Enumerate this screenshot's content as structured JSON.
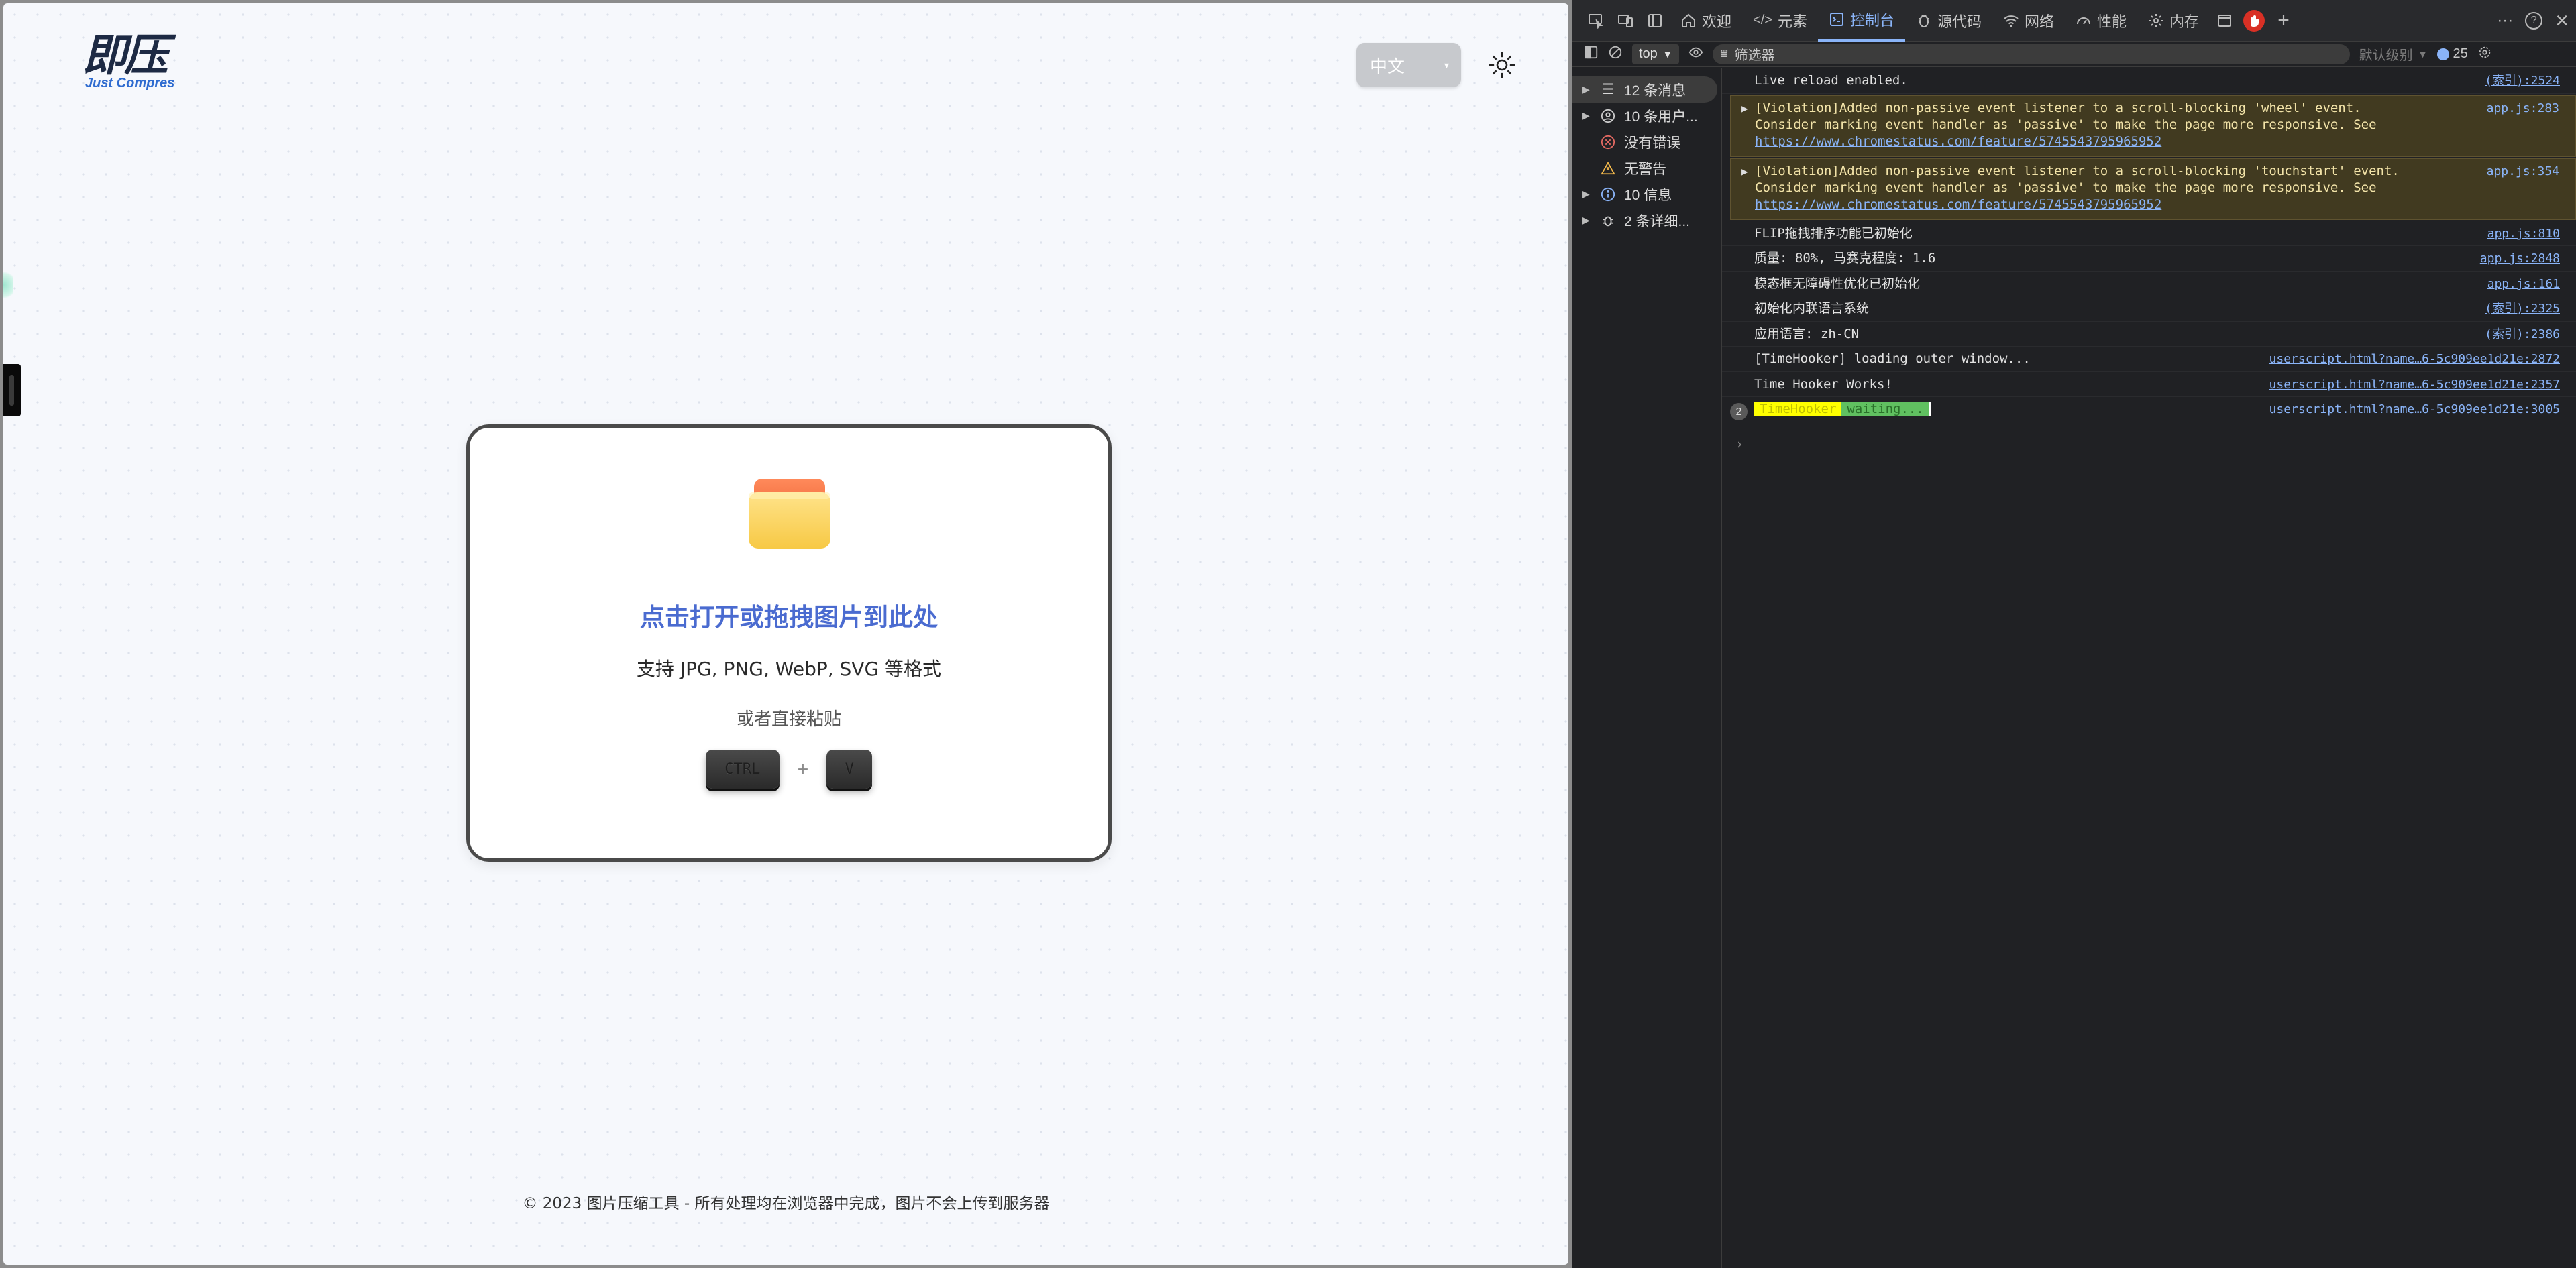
{
  "app": {
    "logo_text": "即压",
    "logo_sub": "Just Compres",
    "language": "中文",
    "dropzone": {
      "title": "点击打开或拖拽图片到此处",
      "formats": "支持 JPG, PNG, WebP, SVG 等格式",
      "paste_hint": "或者直接粘贴",
      "key_ctrl": "CTRL",
      "key_plus": "+",
      "key_v": "V"
    },
    "footer": "© 2023 图片压缩工具 - 所有处理均在浏览器中完成，图片不会上传到服务器"
  },
  "devtools": {
    "tabs": [
      {
        "label": "欢迎",
        "icon": "home-icon"
      },
      {
        "label": "元素",
        "icon": "code-icon"
      },
      {
        "label": "控制台",
        "icon": "console-icon",
        "active": true
      },
      {
        "label": "源代码",
        "icon": "bug-icon"
      },
      {
        "label": "网络",
        "icon": "wifi-icon"
      },
      {
        "label": "性能",
        "icon": "gauge-icon"
      },
      {
        "label": "内存",
        "icon": "gear-icon"
      }
    ],
    "toolbar": {
      "context": "top",
      "filter_placeholder": "筛选器",
      "level": "默认级别",
      "issues": "25"
    },
    "sidebar": [
      {
        "label": "12 条消息",
        "icon": "list-icon",
        "expandable": true,
        "selected": true
      },
      {
        "label": "10 条用户...",
        "icon": "user-icon",
        "expandable": true
      },
      {
        "label": "没有错误",
        "icon": "error-icon",
        "expandable": false
      },
      {
        "label": "无警告",
        "icon": "warning-icon",
        "expandable": false
      },
      {
        "label": "10 信息",
        "icon": "info-icon",
        "expandable": true
      },
      {
        "label": "2 条详细...",
        "icon": "bug-icon",
        "expandable": true
      }
    ],
    "logs": [
      {
        "msg": "Live reload enabled.",
        "src": "(索引):2524"
      },
      {
        "msg": "[Violation]Added non-passive event listener to a scroll-blocking 'wheel' event.\nConsider marking event handler as 'passive' to make the page more responsive. See",
        "link": "https://www.chromestatus.com/feature/5745543795965952",
        "src": "app.js:283",
        "type": "warn"
      },
      {
        "msg": "[Violation]Added non-passive event listener to a scroll-blocking 'touchstart' event.\nConsider marking event handler as 'passive' to make the page more responsive. See",
        "link": "https://www.chromestatus.com/feature/5745543795965952",
        "src": "app.js:354",
        "type": "warn"
      },
      {
        "msg": "FLIP拖拽排序功能已初始化",
        "src": "app.js:810"
      },
      {
        "msg": "质量: 80%, 马赛克程度: 1.6",
        "src": "app.js:2848"
      },
      {
        "msg": "模态框无障碍性优化已初始化",
        "src": "app.js:161"
      },
      {
        "msg": "初始化内联语言系统",
        "src": "(索引):2325"
      },
      {
        "msg": "应用语言: zh-CN",
        "src": "(索引):2386"
      },
      {
        "msg": "[TimeHooker] loading outer window...",
        "src": "userscript.html?name…6-5c909ee1d21e:2872"
      },
      {
        "msg": "Time Hooker Works!",
        "src": "userscript.html?name…6-5c909ee1d21e:2357"
      },
      {
        "badge": "2",
        "chip1": "TimeHooker",
        "chip2": "waiting...",
        "src": "userscript.html?name…6-5c909ee1d21e:3005"
      }
    ]
  }
}
